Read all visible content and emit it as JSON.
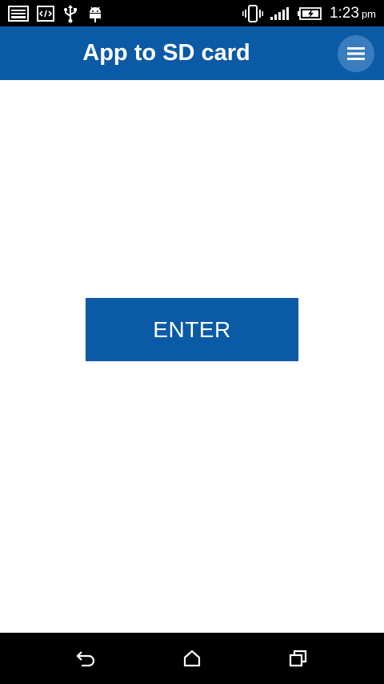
{
  "status_bar": {
    "left_icons": [
      "gallery-icon",
      "code-icon",
      "usb-icon",
      "android-debug-icon"
    ],
    "right_icons": [
      "vibrate-icon",
      "signal-icon",
      "battery-charging-icon"
    ],
    "time": "1:23",
    "ampm": "pm"
  },
  "app_bar": {
    "title": "App to SD card",
    "menu_icon": "hamburger-menu-icon"
  },
  "main": {
    "enter_label": "ENTER"
  },
  "nav_bar": {
    "icons": [
      "back-icon",
      "home-icon",
      "recent-apps-icon"
    ]
  },
  "colors": {
    "primary": "#0b5aa6",
    "menu_circle": "#3a7dbe",
    "status_bar": "#000000",
    "nav_bar": "#000000",
    "background": "#ffffff"
  }
}
